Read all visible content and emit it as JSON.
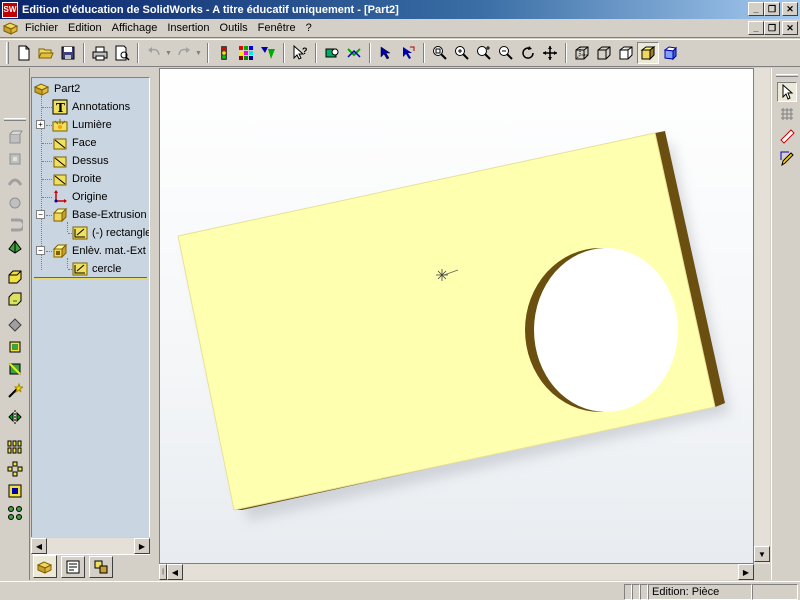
{
  "window": {
    "logo_text": "SW",
    "title": "Edition d'éducation de SolidWorks - A titre éducatif uniquement - [Part2]"
  },
  "menu": {
    "items": [
      "Fichier",
      "Edition",
      "Affichage",
      "Insertion",
      "Outils",
      "Fenêtre",
      "?"
    ]
  },
  "tree": {
    "root": "Part2",
    "items": [
      {
        "label": "Annotations",
        "icon": "annotations-icon"
      },
      {
        "label": "Lumière",
        "icon": "light-icon"
      },
      {
        "label": "Face",
        "icon": "plane-icon"
      },
      {
        "label": "Dessus",
        "icon": "plane-icon"
      },
      {
        "label": "Droite",
        "icon": "plane-icon"
      },
      {
        "label": "Origine",
        "icon": "origin-icon"
      },
      {
        "label": "Base-Extrusion",
        "icon": "extrude-icon"
      },
      {
        "label": "(-) rectangle",
        "icon": "sketch-icon"
      },
      {
        "label": "Enlèv. mat.-Ext",
        "icon": "cut-extrude-icon"
      },
      {
        "label": "cercle",
        "icon": "sketch-icon"
      }
    ]
  },
  "status": {
    "mode": "Edition: Pièce"
  },
  "colors": {
    "part_face": "#ffffb0",
    "part_edge": "#6b4f10",
    "tree_bg": "#c9d5e0",
    "title_bar": "#0a246a"
  }
}
